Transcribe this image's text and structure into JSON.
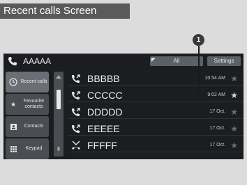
{
  "page_title": "Recent calls Screen",
  "callout_number": "1",
  "header": {
    "device_name": "AAAAA",
    "tab_all": "All",
    "tab_settings": "Settings"
  },
  "menu": [
    {
      "label": "Recent calls",
      "icon": "recent-calls-icon"
    },
    {
      "label": "Favourite contacts",
      "icon": "star-icon"
    },
    {
      "label": "Contacts",
      "icon": "contacts-icon"
    },
    {
      "label": "Keypad",
      "icon": "keypad-icon"
    }
  ],
  "calls": [
    {
      "name": "BBBBB",
      "time": "10:54 AM",
      "type": "outgoing"
    },
    {
      "name": "CCCCC",
      "time": "9:02 AM",
      "type": "outgoing"
    },
    {
      "name": "DDDDD",
      "time": "17 Oct.",
      "type": "outgoing"
    },
    {
      "name": "EEEEE",
      "time": "17 Oct.",
      "type": "outgoing"
    },
    {
      "name": "FFFFF",
      "time": "17 Oct.",
      "type": "missed"
    }
  ],
  "colors": {
    "screen_bg": "#1b1d20",
    "button_bg": "#4a4d52",
    "text": "#f0f0f0"
  }
}
